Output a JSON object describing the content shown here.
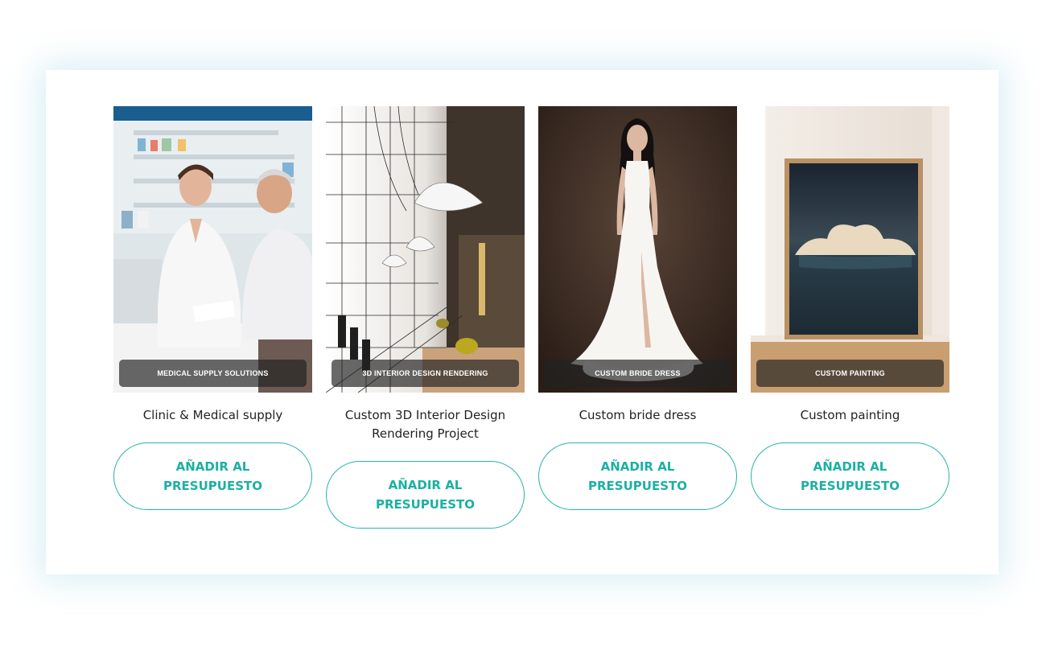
{
  "colors": {
    "accent": "#1bb0a3",
    "button_border": "#26b5a8",
    "caption_bg": "#222222",
    "text": "#222222",
    "panel_glow": "#aadce8"
  },
  "cards": [
    {
      "caption": "MEDICAL SUPPLY SOLUTIONS",
      "title": "Clinic & Medical supply",
      "button_label": "AÑADIR AL PRESUPUESTO",
      "image": "pharmacist-with-customer-photo"
    },
    {
      "caption": "3D INTERIOR DESIGN RENDERING",
      "title": "Custom 3D Interior Design Rendering Project",
      "button_label": "AÑADIR AL PRESUPUESTO",
      "image": "interior-wireframe-render-photo"
    },
    {
      "caption": "CUSTOM BRIDE DRESS",
      "title": "Custom bride dress",
      "button_label": "AÑADIR AL PRESUPUESTO",
      "image": "bride-dress-photo"
    },
    {
      "caption": "CUSTOM PAINTING",
      "title": "Custom painting",
      "button_label": "AÑADIR AL PRESUPUESTO",
      "image": "cloud-painting-photo"
    }
  ]
}
